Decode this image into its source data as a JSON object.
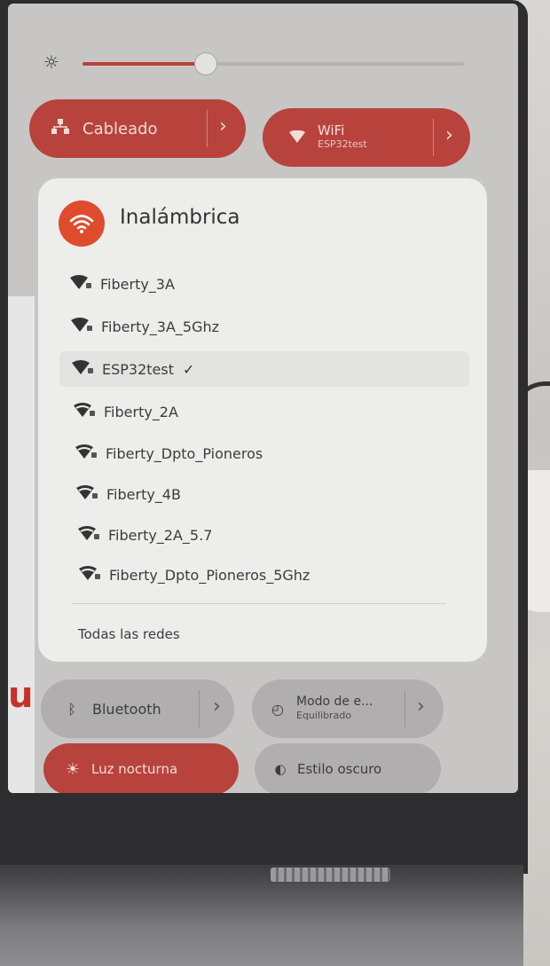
{
  "brightness": {
    "level": 0.32
  },
  "wired_toggle": {
    "label": "Cableado"
  },
  "wifi_toggle": {
    "label": "WiFi",
    "subtitle": "ESP32test"
  },
  "wireless": {
    "title": "Inalámbrica",
    "networks": [
      {
        "name": "Fiberty_3A",
        "signal": "full",
        "locked": true
      },
      {
        "name": "Fiberty_3A_5Ghz",
        "signal": "full",
        "locked": true
      },
      {
        "name": "ESP32test",
        "signal": "full",
        "locked": true,
        "connected": true
      },
      {
        "name": "Fiberty_2A",
        "signal": "medium",
        "locked": true
      },
      {
        "name": "Fiberty_Dpto_Pioneros",
        "signal": "medium",
        "locked": true
      },
      {
        "name": "Fiberty_4B",
        "signal": "medium",
        "locked": true
      },
      {
        "name": "Fiberty_2A_5.7",
        "signal": "medium",
        "locked": true
      },
      {
        "name": "Fiberty_Dpto_Pioneros_5Ghz",
        "signal": "medium",
        "locked": true
      }
    ],
    "all_networks_label": "Todas las redes",
    "check_mark": "✓"
  },
  "bluetooth_toggle": {
    "label": "Bluetooth"
  },
  "power_mode_toggle": {
    "label": "Modo de e...",
    "subtitle": "Equilibrado"
  },
  "night_light_toggle": {
    "label": "Luz nocturna"
  },
  "dark_style_toggle": {
    "label": "Estilo oscuro"
  },
  "colors": {
    "accent": "#b8433c",
    "wifi_badge": "#de4c2d",
    "card": "#ededec"
  }
}
